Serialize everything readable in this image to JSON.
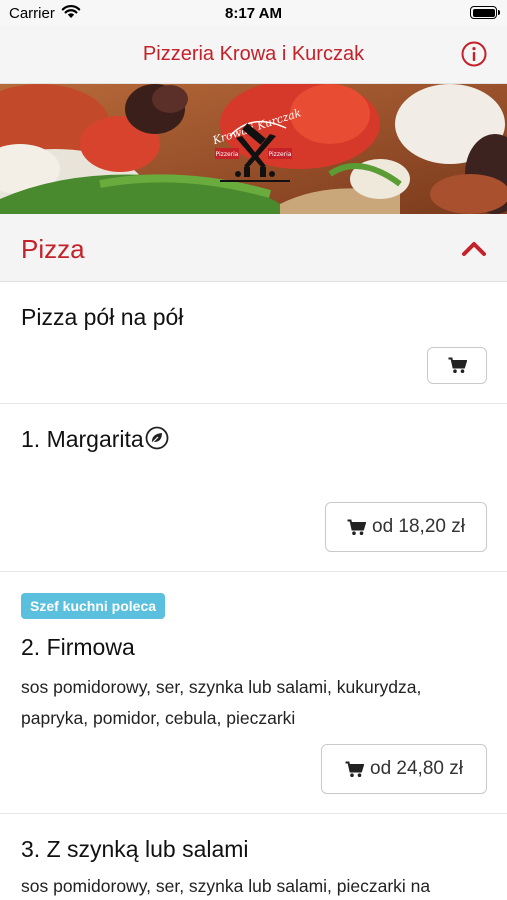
{
  "status_bar": {
    "carrier": "Carrier",
    "time": "8:17 AM"
  },
  "nav": {
    "title": "Pizzeria Krowa i Kurczak",
    "info_icon": "info-icon"
  },
  "hero": {
    "logo_text": "Krowa i Kurczak",
    "logo_sub_left": "Pizzeria",
    "logo_sub_right": "Pizzeria"
  },
  "section": {
    "title": "Pizza",
    "icon": "chevron-up-icon"
  },
  "items": [
    {
      "name": "Pizza pół na pół",
      "price": ""
    },
    {
      "name": "1. Margarita",
      "price": "od 18,20 zł",
      "vegetarian": true
    },
    {
      "badge": "Szef kuchni poleca",
      "name": "2. Firmowa",
      "desc": "sos pomidorowy, ser, szynka lub salami, kukurydza, papryka, pomidor, cebula, pieczarki",
      "price": "od 24,80 zł"
    },
    {
      "name": "3. Z szynką lub salami",
      "desc": "sos pomidorowy, ser, szynka lub salami, pieczarki na"
    }
  ],
  "colors": {
    "accent": "#c42129",
    "badge": "#5bc0de"
  }
}
